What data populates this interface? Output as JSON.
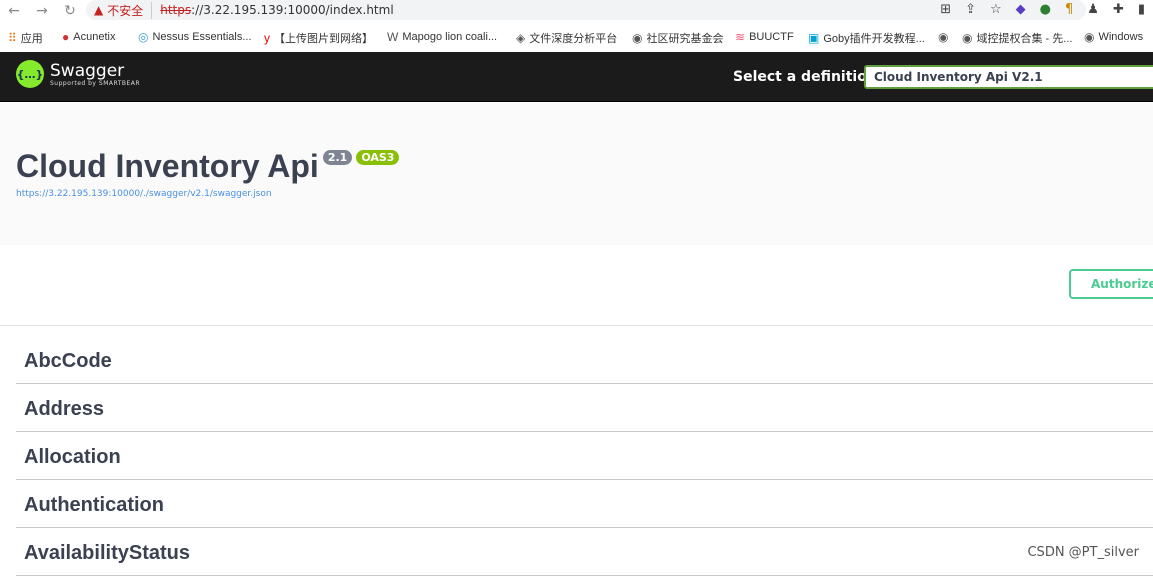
{
  "browser": {
    "insecure_label": "不安全",
    "url_protocol": "https",
    "url_rest": "://3.22.195.139:10000/index.html",
    "bookmarks": [
      "应用",
      "Acunetix",
      "Nessus Essentials...",
      "【上传图片到网络】",
      "Mapogo lion coali...",
      "文件深度分析平台",
      "社区研究基金会",
      "BUUCTF",
      "Goby插件开发教程...",
      "",
      "域控提权合集 - 先...",
      "Windows"
    ]
  },
  "header": {
    "logo_text": "Swagger",
    "logo_sub": "Supported by SMARTBEAR",
    "select_label": "Select a definition",
    "selected_definition": "Cloud Inventory Api V2.1"
  },
  "info": {
    "title": "Cloud Inventory Api",
    "version": "2.1",
    "oas": "OAS3",
    "spec_url": "https://3.22.195.139:10000/./swagger/v2.1/swagger.json"
  },
  "authorize_label": "Authorize",
  "tags": [
    "AbcCode",
    "Address",
    "Allocation",
    "Authentication",
    "AvailabilityStatus"
  ],
  "watermark": "CSDN @PT_silver",
  "colors": {
    "accent": "#49cc90",
    "topbar": "#1b1b1b",
    "logo": "#85ea2d"
  }
}
